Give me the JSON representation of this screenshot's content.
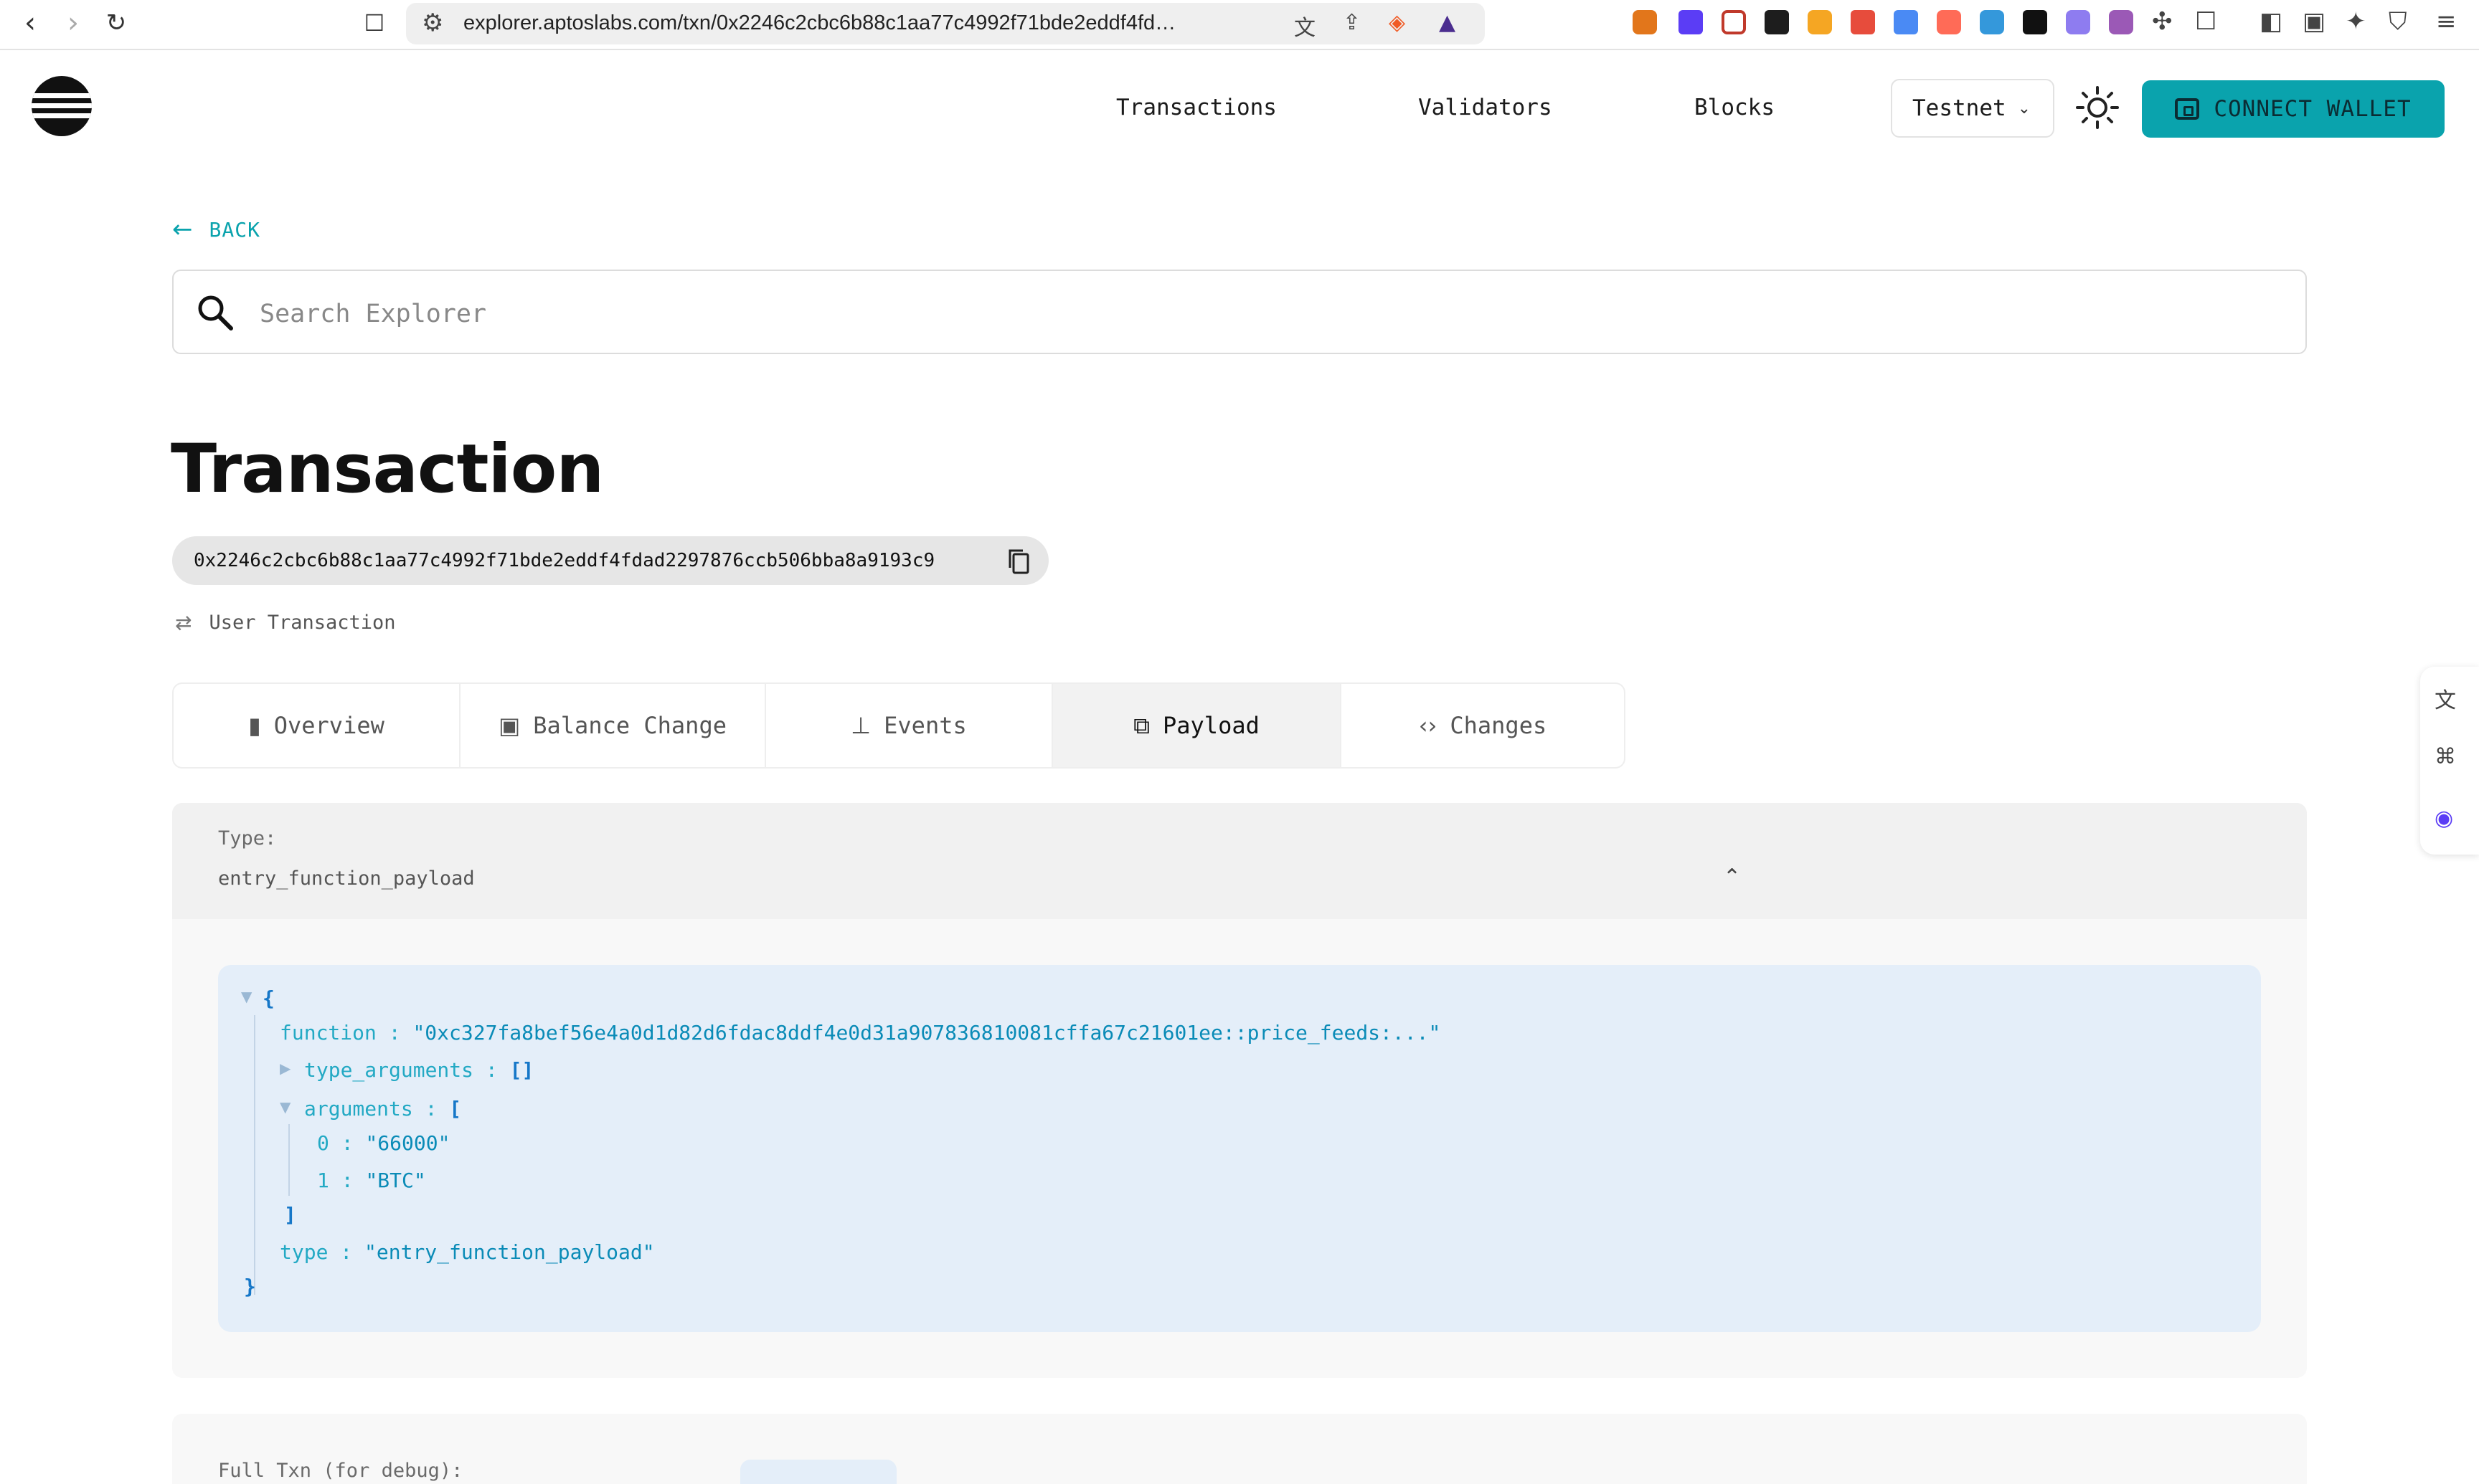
{
  "browser": {
    "url": "explorer.aptoslabs.com/txn/0x2246c2cbc6b88c1aa77c4992f71bde2eddf4fdad2297..."
  },
  "header": {
    "nav": [
      "Transactions",
      "Validators",
      "Blocks"
    ],
    "network": "Testnet",
    "connect_label": "CONNECT WALLET",
    "accent": "#0aa3ad"
  },
  "back_label": "BACK",
  "search": {
    "placeholder": "Search Explorer"
  },
  "page_title": "Transaction",
  "txn": {
    "hash": "0x2246c2cbc6b88c1aa77c4992f71bde2eddf4fdad2297876ccb506bba8a9193c9",
    "kind": "User Transaction"
  },
  "tabs": [
    {
      "label": "Overview",
      "icon": "bar-chart-icon"
    },
    {
      "label": "Balance Change",
      "icon": "wallet-icon"
    },
    {
      "label": "Events",
      "icon": "pin-icon"
    },
    {
      "label": "Payload",
      "icon": "copy-icon",
      "active": true
    },
    {
      "label": "Changes",
      "icon": "code-icon"
    }
  ],
  "type_section": {
    "label": "Type:",
    "value": "entry_function_payload"
  },
  "payload": {
    "function_key": "function",
    "function_value": "\"0xc327fa8bef56e4a0d1d82d6fdac8ddf4e0d31a907836810081cffa67c21601ee::price_feeds:...\"",
    "type_arguments_key": "type_arguments",
    "type_arguments_value": "[]",
    "arguments_key": "arguments",
    "arguments": [
      {
        "index": "0",
        "value": "\"66000\""
      },
      {
        "index": "1",
        "value": "\"BTC\""
      }
    ],
    "type_key": "type",
    "type_value": "\"entry_function_payload\""
  },
  "debug_label": "Full Txn (for debug):"
}
